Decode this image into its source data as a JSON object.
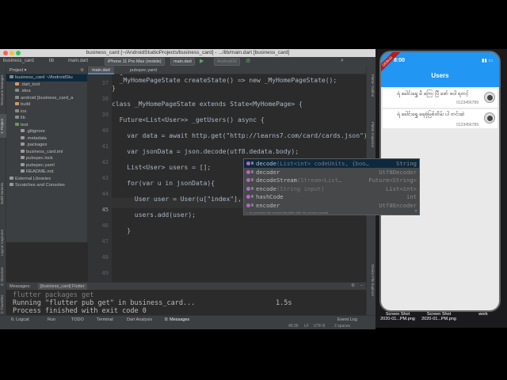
{
  "window": {
    "title": "business_card [~/AndroidStudioProjects/business_card] - .../lib/main.dart [business_card]"
  },
  "navbar": {
    "crumbs": [
      "business_card",
      "lib",
      "main.dart"
    ],
    "device": "iPhone 11 Pro Max (mobile)",
    "run_config": "main.dart",
    "sdk": "Android16"
  },
  "left_strip": [
    "Resource Manager",
    "1: Project",
    "Build Variants",
    "Layout Captures",
    "Z: Structure",
    "2: Favorites"
  ],
  "right_strip": [
    "Flutter Outline",
    "Flutter Inspector",
    "Device File Explorer"
  ],
  "project": {
    "header": "Project",
    "items": [
      {
        "label": "business_card  ~/AndroidStu",
        "indent": 0,
        "color": "#8a8a8a"
      },
      {
        "label": ".dart_tool",
        "indent": 1,
        "color": "#d19a66"
      },
      {
        "label": ".idea",
        "indent": 1,
        "color": "#8a8a8a"
      },
      {
        "label": "android [business_card_a",
        "indent": 1,
        "color": "#8a8a8a"
      },
      {
        "label": "build",
        "indent": 1,
        "color": "#d19a66"
      },
      {
        "label": "ios",
        "indent": 1,
        "color": "#8a8a8a"
      },
      {
        "label": "lib",
        "indent": 1,
        "color": "#8a8a8a"
      },
      {
        "label": "test",
        "indent": 1,
        "color": "#6a9955"
      },
      {
        "label": ".gitignore",
        "indent": 2,
        "color": "#999"
      },
      {
        "label": ".metadata",
        "indent": 2,
        "color": "#999"
      },
      {
        "label": ".packages",
        "indent": 2,
        "color": "#999"
      },
      {
        "label": "business_card.iml",
        "indent": 2,
        "color": "#999"
      },
      {
        "label": "pubspec.lock",
        "indent": 2,
        "color": "#999"
      },
      {
        "label": "pubspec.yaml",
        "indent": 2,
        "color": "#999"
      },
      {
        "label": "README.md",
        "indent": 2,
        "color": "#999"
      },
      {
        "label": "External Libraries",
        "indent": 0,
        "color": "#999"
      },
      {
        "label": "Scratches and Consoles",
        "indent": 0,
        "color": "#999"
      }
    ]
  },
  "editor_tabs": [
    "main.dart",
    "pubspec.yaml"
  ],
  "editor": {
    "line_numbers": [
      "37",
      "38",
      "39",
      "40",
      "41",
      "42",
      "43",
      "44",
      "45",
      "46",
      "47",
      "48",
      "49",
      "50",
      "51"
    ],
    "current_line": "45",
    "lines": [
      "  @override",
      "  _MyHomePageState createState() => new _MyHomePageState();",
      "}",
      "",
      "class _MyHomePageState extends State<MyHomePage> {",
      "",
      "  Future<List<User>> _getUsers() async {",
      "",
      "    var data = await http.get(\"http://learns7.com/card/cards.json\");",
      "",
      "    var jsonData = json.decode(utf8.dedata.body);",
      "",
      "    List<User> users = [];",
      "",
      "    for(var u in jsonData){",
      "",
      "      User user = User(u[\"index\"],",
      "",
      "      users.add(user);",
      "",
      "    }"
    ]
  },
  "autocomplete": {
    "items": [
      {
        "name": "decode",
        "sig": "(List<int> codeUnits, {boo…",
        "type": "String"
      },
      {
        "name": "decoder",
        "sig": "",
        "type": "Utf8Decoder"
      },
      {
        "name": "decodeStream",
        "sig": "(Stream<List…",
        "type": "Future<String>"
      },
      {
        "name": "encode",
        "sig": "(String input)",
        "type": "List<int>"
      },
      {
        "name": "hashCode",
        "sig": "",
        "type": "int"
      },
      {
        "name": "encoder",
        "sig": "",
        "type": "Utf8Encoder"
      }
    ],
    "hint": "^↓ to overwrite the current identifier with the chosen variant"
  },
  "messages": {
    "tab1": "Messages:",
    "tab2": "[business_card] Flutter",
    "lines": [
      "flutter packages get",
      "Running \"flutter pub get\" in business_card...",
      "Process finished with exit code 0"
    ],
    "duration": "1.5s"
  },
  "bottom_tabs": [
    "6: Logcat",
    "Run",
    "TODO",
    "Terminal",
    "Dart Analysis",
    "0: Messages",
    "Event Log"
  ],
  "status": {
    "position": "45:39",
    "line_sep": "LF",
    "encoding": "UTF-8",
    "indent": "2 spaces"
  },
  "phone": {
    "time": "8:00",
    "app_title": "Users",
    "debug": "DEBUG",
    "cards": [
      {
        "name": "ရဲ ခေါင်းရွှေ မိ ကြေး ပြီ ဖော် ဖဝါ ရတင့်",
        "phone": "0123456789"
      },
      {
        "name": "ရဲ ခေါင်းရွှေ ရေစုံမြစ်ထိမ်း ပါ တင်းဆဲ",
        "phone": "0123456789"
      }
    ]
  },
  "desktop_files": [
    {
      "label": "Screen Shot\n2020-01...PM.png"
    },
    {
      "label": "Screen Shot\n2020-01...PM.png"
    },
    {
      "label": "work"
    }
  ]
}
